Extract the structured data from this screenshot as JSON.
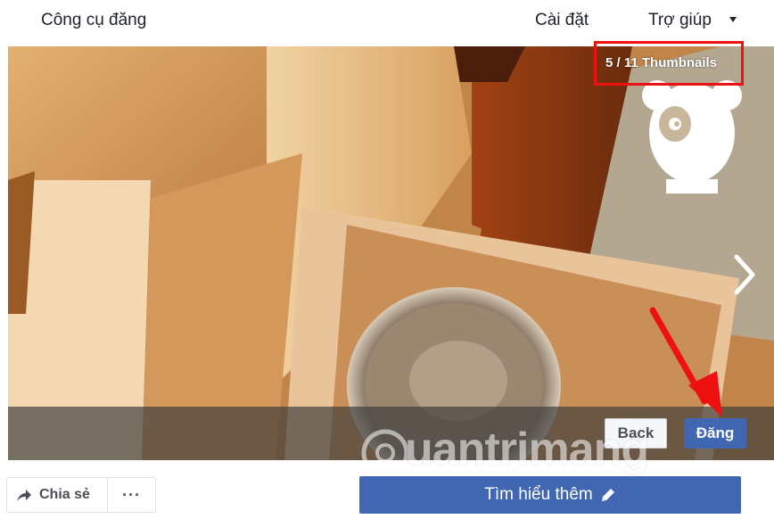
{
  "topbar": {
    "tools_label": "Công cụ đăng",
    "settings_label": "Cài đặt",
    "help_label": "Trợ giúp",
    "help_icon": "caret-down-icon"
  },
  "media": {
    "counter": "5 / 11 Thumbnails",
    "next_icon": "chevron-right-icon",
    "brand_icon": "panda-logo-icon"
  },
  "actions": {
    "back_label": "Back",
    "post_label": "Đăng"
  },
  "watermark": {
    "text": "uantrimang"
  },
  "footer": {
    "share_label": "Chia sẻ",
    "more_label": "···",
    "learn_more_label": "Tìm hiểu thêm"
  },
  "colors": {
    "primary": "#4267b2",
    "highlight_box": "#ee1111",
    "annotation_arrow": "#ee1111"
  }
}
